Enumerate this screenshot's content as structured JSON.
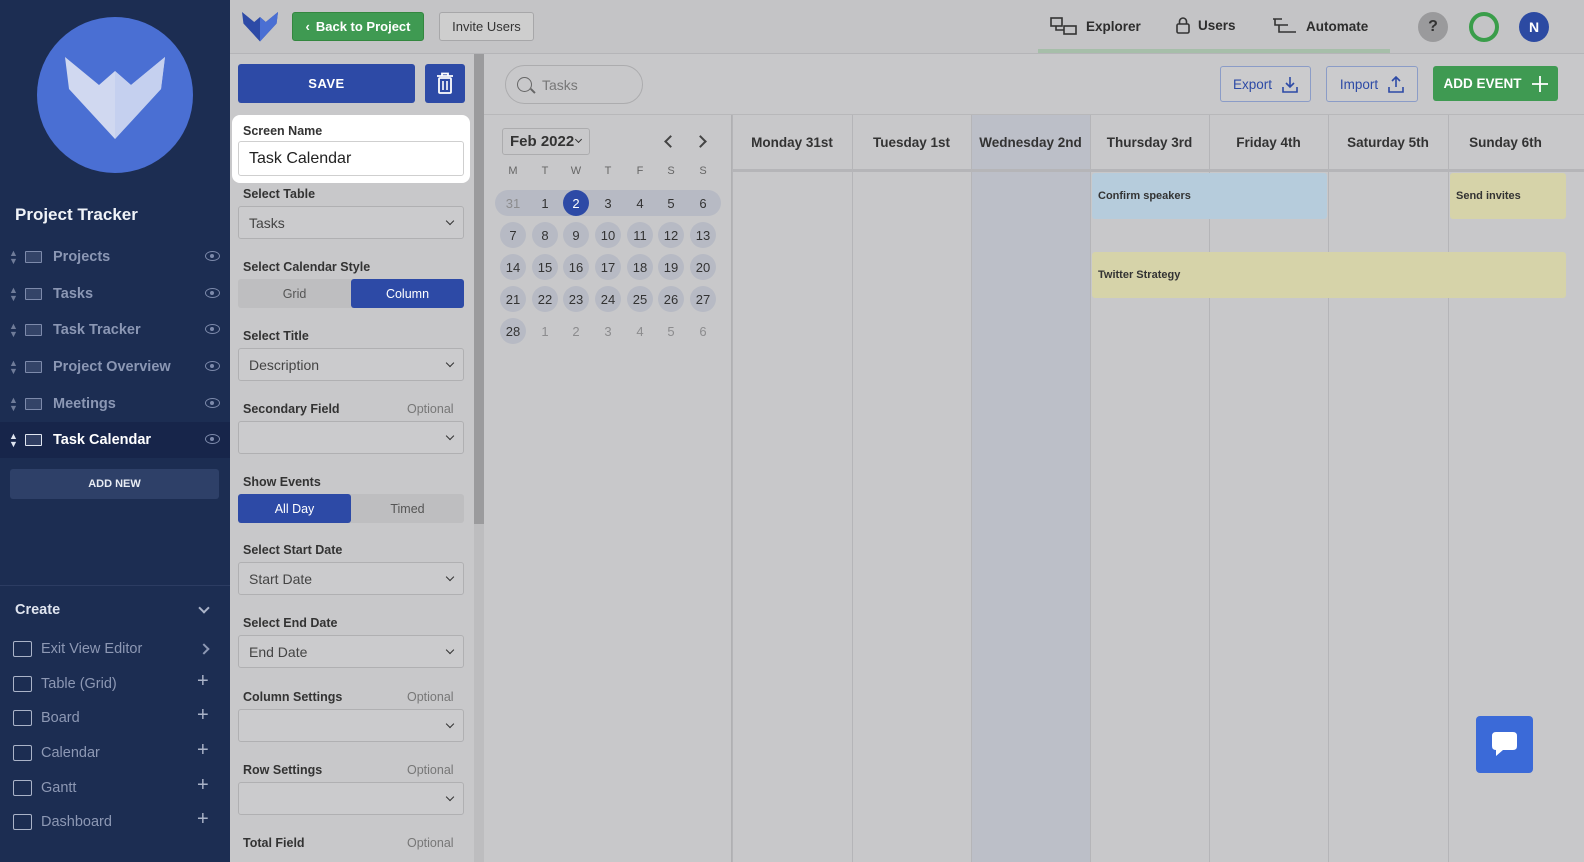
{
  "sidebar": {
    "project_title": "Project Tracker",
    "items": [
      {
        "label": "Projects"
      },
      {
        "label": "Tasks"
      },
      {
        "label": "Task Tracker"
      },
      {
        "label": "Project Overview"
      },
      {
        "label": "Meetings"
      },
      {
        "label": "Task Calendar",
        "active": true
      }
    ],
    "add_new": "ADD NEW",
    "create_title": "Create",
    "create_items": [
      {
        "label": "Exit View Editor"
      },
      {
        "label": "Table (Grid)"
      },
      {
        "label": "Board"
      },
      {
        "label": "Calendar"
      },
      {
        "label": "Gantt"
      },
      {
        "label": "Dashboard"
      }
    ]
  },
  "topbar": {
    "back_label": "Back to Project",
    "invite_label": "Invite Users",
    "nav": [
      {
        "label": "Explorer",
        "icon": "explorer-icon"
      },
      {
        "label": "Users",
        "icon": "lock-icon"
      },
      {
        "label": "Automate",
        "icon": "automate-icon"
      }
    ],
    "help": "?",
    "avatar": "N"
  },
  "settings": {
    "save_label": "SAVE",
    "screen_name_label": "Screen Name",
    "screen_name_value": "Task Calendar",
    "select_table_label": "Select Table",
    "select_table_value": "Tasks",
    "calendar_style_label": "Select Calendar Style",
    "style_options": [
      "Grid",
      "Column"
    ],
    "select_title_label": "Select Title",
    "select_title_value": "Description",
    "secondary_field_label": "Secondary Field",
    "optional": "Optional",
    "show_events_label": "Show Events",
    "event_options": [
      "All Day",
      "Timed"
    ],
    "start_date_label": "Select Start Date",
    "start_date_value": "Start Date",
    "end_date_label": "Select End Date",
    "end_date_value": "End Date",
    "column_settings_label": "Column Settings",
    "row_settings_label": "Row Settings",
    "total_field_label": "Total Field"
  },
  "calendar": {
    "search_placeholder": "Tasks",
    "export_label": "Export",
    "import_label": "Import",
    "add_event_label": "ADD EVENT",
    "month_label": "Feb 2022",
    "weekday_initials": [
      "M",
      "T",
      "W",
      "T",
      "F",
      "S",
      "S"
    ],
    "mini_weeks": [
      [
        "31",
        "1",
        "2",
        "3",
        "4",
        "5",
        "6"
      ],
      [
        "7",
        "8",
        "9",
        "10",
        "11",
        "12",
        "13"
      ],
      [
        "14",
        "15",
        "16",
        "17",
        "18",
        "19",
        "20"
      ],
      [
        "21",
        "22",
        "23",
        "24",
        "25",
        "26",
        "27"
      ],
      [
        "28",
        "1",
        "2",
        "3",
        "4",
        "5",
        "6"
      ]
    ],
    "selected_day": "2",
    "week_days": [
      "Monday 31st",
      "Tuesday 1st",
      "Wednesday 2nd",
      "Thursday 3rd",
      "Friday 4th",
      "Saturday 5th",
      "Sunday 6th"
    ],
    "events": [
      {
        "title": "Confirm speakers",
        "color": "#b6ccdc"
      },
      {
        "title": "Send invites",
        "color": "#d6d3a9"
      },
      {
        "title": "Twitter Strategy",
        "color": "#d6d3a9"
      }
    ]
  },
  "colors": {
    "sidebar_bg": "#1c2d52",
    "primary": "#2d4aa6",
    "green": "#3f9a52"
  }
}
